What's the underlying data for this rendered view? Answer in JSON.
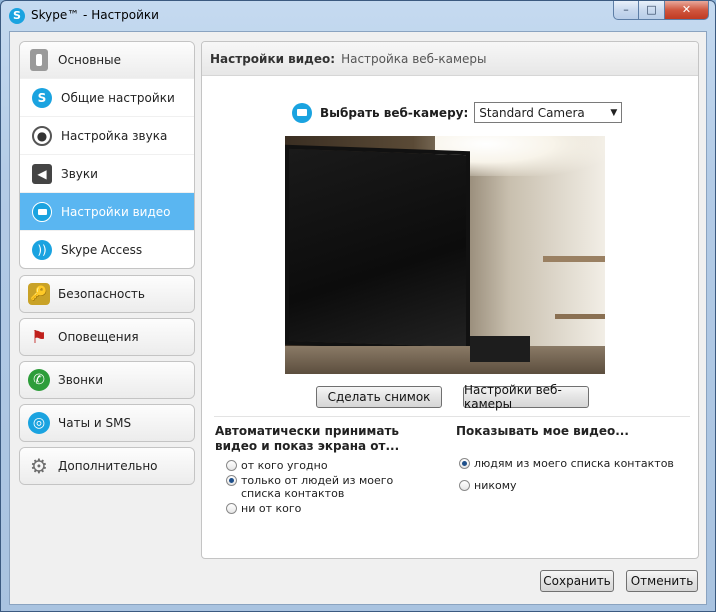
{
  "window": {
    "title": "Skype™ - Настройки",
    "app_icon": "S",
    "min": "–",
    "max": "□",
    "close": "✕"
  },
  "sidebar": {
    "main_group": {
      "label": "Основные",
      "items": [
        {
          "label": "Общие настройки",
          "icon": "skype-icon"
        },
        {
          "label": "Настройка звука",
          "icon": "microphone-icon"
        },
        {
          "label": "Звуки",
          "icon": "speaker-icon"
        },
        {
          "label": "Настройки видео",
          "icon": "video-icon",
          "active": true
        },
        {
          "label": "Skype Access",
          "icon": "wifi-icon"
        }
      ]
    },
    "groups": [
      {
        "label": "Безопасность",
        "icon": "lock-icon",
        "color": "#c9a227"
      },
      {
        "label": "Оповещения",
        "icon": "flag-icon",
        "color": "#c0201c"
      },
      {
        "label": "Звонки",
        "icon": "phone-icon",
        "color": "#2d9d3a"
      },
      {
        "label": "Чаты и SMS",
        "icon": "chat-icon",
        "color": "#1aa3e0"
      },
      {
        "label": "Дополнительно",
        "icon": "gear-icon",
        "color": "#7d7d7d"
      }
    ]
  },
  "panel": {
    "header_title": "Настройки видео:",
    "header_subtitle": "Настройка веб-камеры",
    "camera_label": "Выбрать веб-камеру:",
    "camera_value": "Standard Camera",
    "snapshot_button": "Сделать снимок",
    "webcam_settings_button": "Настройки веб-камеры",
    "auto_accept": {
      "title": "Автоматически принимать видео и показ экрана от...",
      "options": [
        {
          "label": "от кого угодно",
          "checked": false
        },
        {
          "label": "только от людей из моего списка контактов",
          "checked": true
        },
        {
          "label": "ни от кого",
          "checked": false
        }
      ]
    },
    "show_video": {
      "title": "Показывать мое видео...",
      "options": [
        {
          "label": "людям из моего списка контактов",
          "checked": true
        },
        {
          "label": "никому",
          "checked": false
        }
      ]
    }
  },
  "footer": {
    "save": "Сохранить",
    "cancel": "Отменить"
  },
  "colors": {
    "accent": "#5ab6f1",
    "skype_blue": "#1aa3e0"
  }
}
